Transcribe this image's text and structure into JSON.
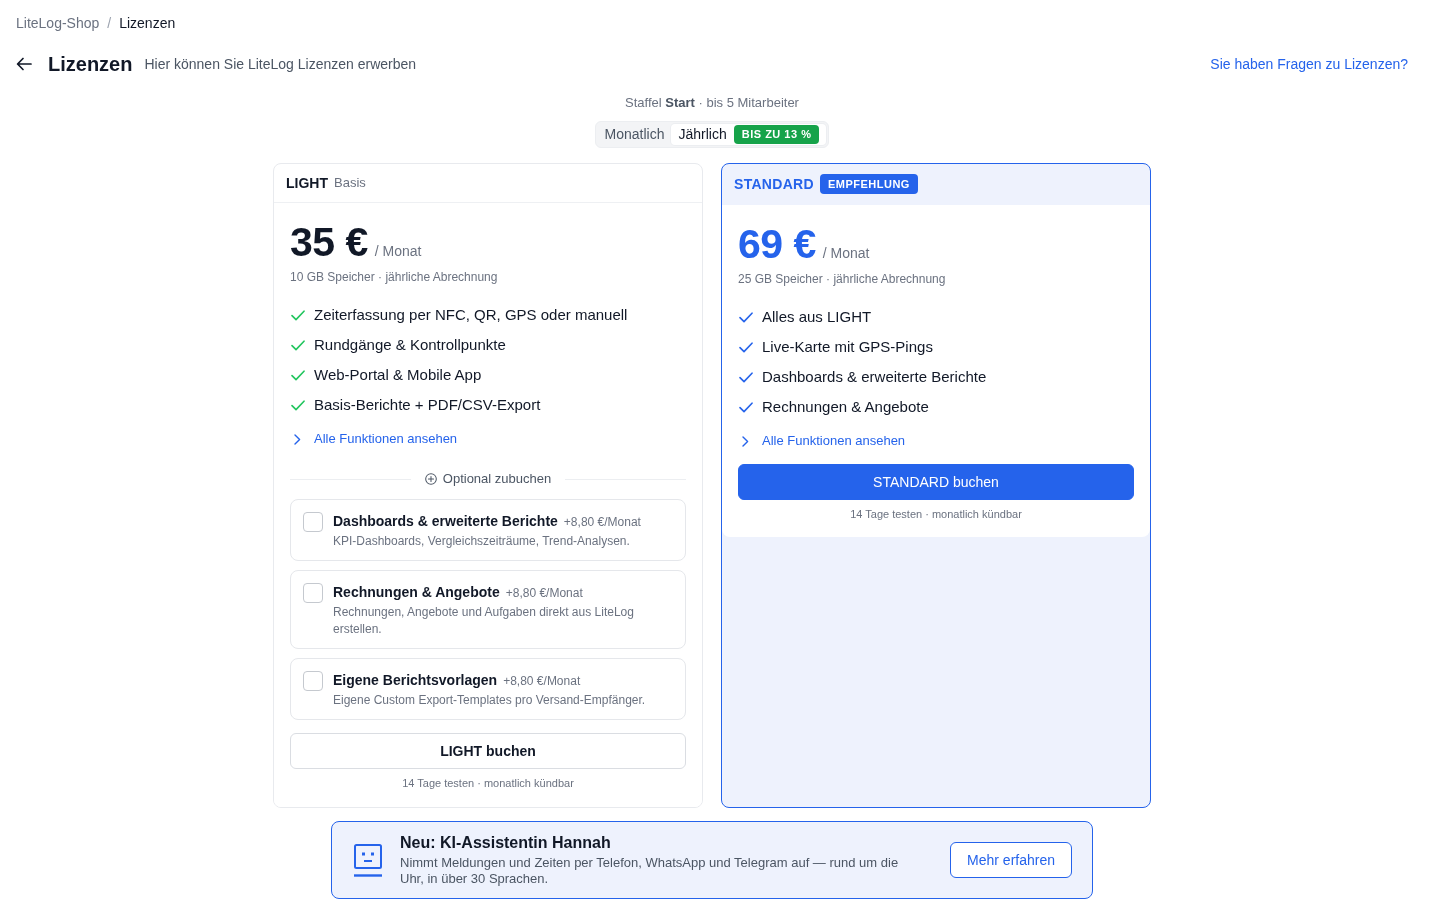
{
  "breadcrumb": {
    "items": [
      {
        "label": "LiteLog-Shop",
        "current": false
      },
      {
        "label": "Lizenzen",
        "current": true
      }
    ],
    "separator": "/"
  },
  "header": {
    "title": "Lizenzen",
    "subtitle": "Hier können Sie LiteLog Lizenzen erwerben",
    "help_link": "Sie haben Fragen zu Lizenzen?"
  },
  "tier_info": "Staffel **Start** · bis 5 Mitarbeiter",
  "billing_toggle": [
    {
      "label": "Monatlich",
      "selected": false
    },
    {
      "label": "Jährlich",
      "selected": true,
      "badge": "BIS ZU 13 %"
    }
  ],
  "plans": [
    {
      "name": "LIGHT",
      "tag": "Basis",
      "recommended": false,
      "price": "35 €",
      "period": "/ Monat",
      "details": "10 GB Speicher · jährliche Abrechnung",
      "features": [
        "Zeiterfassung per NFC, QR, GPS oder manuell",
        "Rundgänge & Kontrollpunkte",
        "Web-Portal & Mobile App",
        "Basis-Berichte + PDF/CSV-Export"
      ],
      "all_features_link": "Alle Funktionen ansehen",
      "addons_heading": "Optional zubuchen",
      "addons": [
        {
          "title": "Dashboards & erweiterte Berichte",
          "price": "+8,80 €/Monat",
          "description": "KPI-Dashboards, Vergleichszeiträume, Trend-Analysen.",
          "checked": false
        },
        {
          "title": "Rechnungen & Angebote",
          "price": "+8,80 €/Monat",
          "description": "Rechnungen, Angebote und Aufgaben direkt aus LiteLog erstellen.",
          "checked": false
        },
        {
          "title": "Eigene Berichtsvorlagen",
          "price": "+8,80 €/Monat",
          "description": "Eigene Custom Export-Templates pro Versand-Empfänger.",
          "checked": false
        }
      ],
      "book_button": "LIGHT buchen",
      "note": "14 Tage testen · monatlich kündbar"
    },
    {
      "name": "STANDARD",
      "tag": "EMPFEHLUNG",
      "recommended": true,
      "price": "69 €",
      "period": "/ Monat",
      "details": "25 GB Speicher · jährliche Abrechnung",
      "features": [
        "Alles aus LIGHT",
        "Live-Karte mit GPS-Pings",
        "Dashboards & erweiterte Berichte",
        "Rechnungen & Angebote"
      ],
      "all_features_link": "Alle Funktionen ansehen",
      "book_button": "STANDARD buchen",
      "note": "14 Tage testen · monatlich kündbar"
    }
  ],
  "banner": {
    "title": "Neu: KI-Assistentin Hannah",
    "description": "Nimmt Meldungen und Zeiten per Telefon, WhatsApp und Telegram auf — rund um die Uhr, in über 30 Sprachen.",
    "button": "Mehr erfahren"
  }
}
